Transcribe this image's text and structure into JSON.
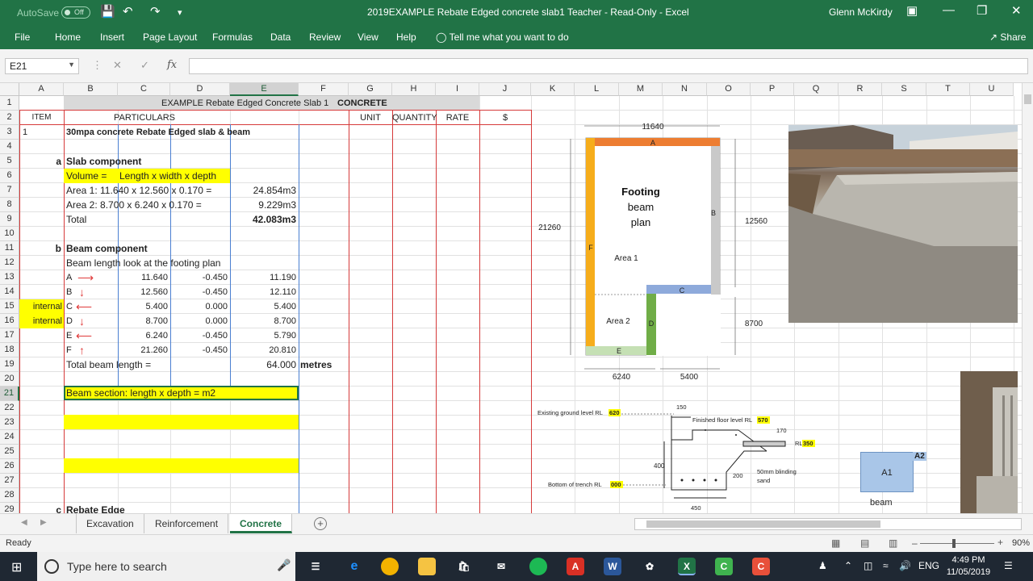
{
  "titlebar": {
    "autosave_label": "AutoSave",
    "autosave_state": "Off",
    "doc_title": "2019EXAMPLE Rebate Edged concrete slab1 Teacher  -  Read-Only  -  Excel",
    "user": "Glenn McKirdy"
  },
  "ribbon": {
    "tabs": [
      "File",
      "Home",
      "Insert",
      "Page Layout",
      "Formulas",
      "Data",
      "Review",
      "View",
      "Help"
    ],
    "tell_me": "Tell me what you want to do",
    "share": "Share"
  },
  "formula_bar": {
    "name_box": "E21",
    "fx": "fx",
    "value": ""
  },
  "columns": [
    "A",
    "B",
    "C",
    "D",
    "E",
    "F",
    "G",
    "H",
    "I",
    "J",
    "K",
    "L",
    "M",
    "N",
    "O",
    "P",
    "Q",
    "R",
    "S",
    "T",
    "U"
  ],
  "rows": [
    "1",
    "2",
    "3",
    "4",
    "5",
    "6",
    "7",
    "8",
    "9",
    "10",
    "11",
    "12",
    "13",
    "14",
    "15",
    "16",
    "17",
    "18",
    "19",
    "20",
    "21",
    "22",
    "23",
    "24",
    "25",
    "26",
    "27",
    "28",
    "29"
  ],
  "sheet": {
    "title": "EXAMPLE Rebate Edged Concrete Slab 1",
    "title_tag": "CONCRETE",
    "headers": {
      "item": "ITEM",
      "particulars": "PARTICULARS",
      "unit": "UNIT",
      "quantity": "QUANTITY",
      "rate": "RATE",
      "dollar": "$"
    },
    "r3": {
      "item": "1",
      "desc": "30mpa concrete Rebate Edged slab & beam"
    },
    "r5": {
      "sub": "a",
      "label": "Slab component"
    },
    "r6": {
      "a": "Volume =",
      "b": "Length x width x depth"
    },
    "r7": {
      "desc": "Area 1: 11.640 x 12.560 x 0.170 =",
      "val": "24.854m3"
    },
    "r8": {
      "desc": "Area 2:  8.700 x 6.240 x 0.170 =",
      "val": "9.229m3"
    },
    "r9": {
      "desc": "Total",
      "val": "42.083m3"
    },
    "r11": {
      "sub": "b",
      "label": "Beam component"
    },
    "r12": {
      "desc": "Beam length look at the footing plan"
    },
    "beam_rows": [
      {
        "tag": "",
        "letter": "A",
        "arrow": "⟶",
        "c": "11.640",
        "d": "-0.450",
        "e": "11.190"
      },
      {
        "tag": "",
        "letter": "B",
        "arrow": "↓",
        "c": "12.560",
        "d": "-0.450",
        "e": "12.110"
      },
      {
        "tag": "internal",
        "letter": "C",
        "arrow": "⟵",
        "c": "5.400",
        "d": "0.000",
        "e": "5.400"
      },
      {
        "tag": "internal",
        "letter": "D",
        "arrow": "↓",
        "c": "8.700",
        "d": "0.000",
        "e": "8.700"
      },
      {
        "tag": "",
        "letter": "E",
        "arrow": "⟵",
        "c": "6.240",
        "d": "-0.450",
        "e": "5.790"
      },
      {
        "tag": "",
        "letter": "F",
        "arrow": "↑",
        "c": "21.260",
        "d": "-0.450",
        "e": "20.810"
      }
    ],
    "r19": {
      "desc": "Total beam length =",
      "val": "64.000",
      "unit": "metres"
    },
    "r21": {
      "desc": "Beam section: length x depth = m2"
    },
    "r29": {
      "sub": "c",
      "label": "Rebate Edge"
    }
  },
  "plan": {
    "top_dim": "11640",
    "left_dim": "21260",
    "right_dim": "12560",
    "right_dim2": "8700",
    "bottom_dim1": "6240",
    "bottom_dim2": "5400",
    "title1": "Footing",
    "title2": "beam",
    "title3": "plan",
    "area1": "Area 1",
    "area2": "Area 2",
    "labels": [
      "A",
      "B",
      "C",
      "D",
      "E",
      "F"
    ],
    "colors": {
      "A": "#ed7d31",
      "B": "#c9c9c9",
      "C": "#8eaadb",
      "D": "#70ad47",
      "E": "#c5e0b4",
      "F": "#f4b183"
    }
  },
  "section": {
    "egl": "Existing ground level RL",
    "egl_val": "620",
    "ffl": "Finished floor level RL",
    "ffl_val": "570",
    "rl": "RL",
    "rl_val": "350",
    "bot": "Bottom of trench RL",
    "bot_val": "000",
    "d150": "150",
    "d170": "170",
    "d400": "400",
    "d200": "200",
    "d450": "450",
    "blinding1": "50mm blinding",
    "blinding2": "sand"
  },
  "shapes": {
    "a1": "A1",
    "a2": "A2",
    "beam": "beam"
  },
  "sheet_tabs": [
    "Excavation",
    "Reinforcement",
    "Concrete"
  ],
  "status": {
    "ready": "Ready",
    "zoom": "90%"
  },
  "taskbar": {
    "search": "Type here to search",
    "lang": "ENG",
    "time": "4:49 PM",
    "date": "11/05/2019"
  }
}
